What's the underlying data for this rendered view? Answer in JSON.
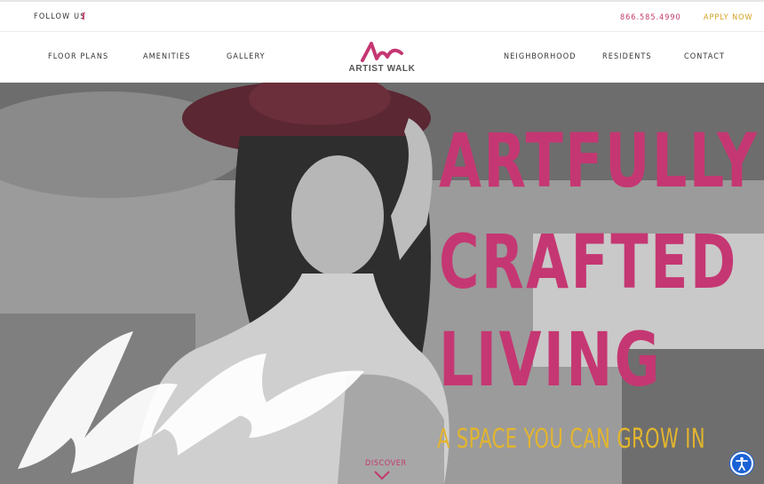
{
  "topbar": {
    "follow_label": "FOLLOW US",
    "social_icon": "facebook-icon",
    "phone": "866.585.4990",
    "apply_label": "APPLY NOW"
  },
  "nav": {
    "items_left": [
      "FLOOR PLANS",
      "AMENITIES",
      "GALLERY"
    ],
    "items_right": [
      "NEIGHBORHOOD",
      "RESIDENTS",
      "CONTACT"
    ],
    "logo_text": "ARTIST WALK"
  },
  "hero": {
    "headline_lines": [
      "ARTFULLY",
      "CRAFTED",
      "LIVING"
    ],
    "tagline": "A SPACE YOU CAN GROW IN",
    "discover_label": "DISCOVER",
    "discover_icon": "chevron-down-icon",
    "accessibility_icon": "accessibility-icon"
  },
  "colors": {
    "brand_pink": "#c53772",
    "brand_gold": "#e3b52e",
    "accessibility_blue": "#1b62d6"
  }
}
